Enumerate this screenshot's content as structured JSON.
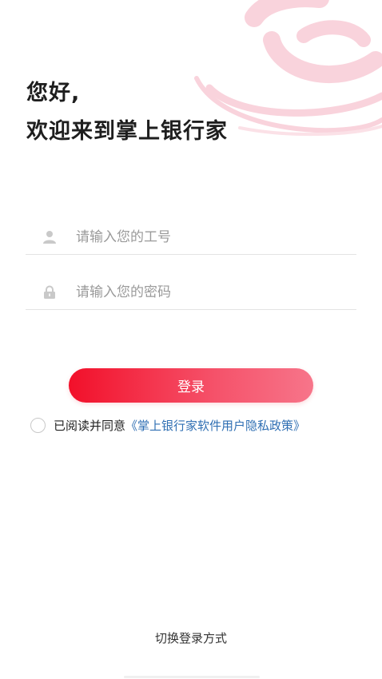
{
  "greeting": {
    "line1": "您好,",
    "line2": "欢迎来到掌上银行家"
  },
  "form": {
    "username": {
      "placeholder": "请输入您的工号",
      "value": "",
      "icon": "user-icon"
    },
    "password": {
      "placeholder": "请输入您的密码",
      "value": "",
      "icon": "lock-icon"
    }
  },
  "login_button": {
    "label": "登录"
  },
  "agreement": {
    "checked": false,
    "prefix": "已阅读并同意",
    "policy_link": "《掌上银行家软件用户隐私政策》"
  },
  "switch_login": {
    "label": "切换登录方式"
  },
  "colors": {
    "brand_red": "#f2102a",
    "brand_pink": "#f7758a",
    "logo_watermark": "#f9d3dc",
    "link": "#2f6fb3"
  },
  "background_logo": {
    "icon": "brand-logo-watermark"
  }
}
